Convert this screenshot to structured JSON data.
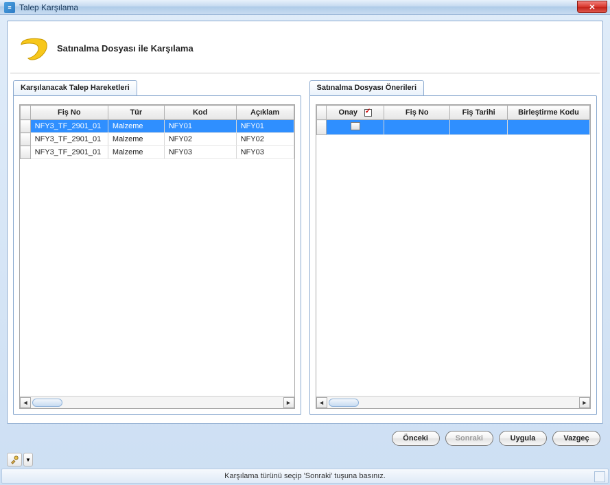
{
  "window": {
    "title": "Talep Karşılama"
  },
  "header": {
    "title": "Satınalma Dosyası ile Karşılama"
  },
  "left_panel": {
    "title": "Karşılanacak Talep Hareketleri",
    "columns": {
      "fis_no": "Fiş No",
      "tur": "Tür",
      "kod": "Kod",
      "aciklama": "Açıklam"
    },
    "rows": [
      {
        "fis_no": "NFY3_TF_2901_01",
        "tur": "Malzeme",
        "kod": "NFY01",
        "aciklama": "NFY01",
        "selected": true
      },
      {
        "fis_no": "NFY3_TF_2901_01",
        "tur": "Malzeme",
        "kod": "NFY02",
        "aciklama": "NFY02",
        "selected": false
      },
      {
        "fis_no": "NFY3_TF_2901_01",
        "tur": "Malzeme",
        "kod": "NFY03",
        "aciklama": "NFY03",
        "selected": false
      }
    ]
  },
  "right_panel": {
    "title": "Satınalma Dosyası Önerileri",
    "columns": {
      "onay": "Onay",
      "fis_no": "Fiş No",
      "fis_tarihi": "Fiş Tarihi",
      "birlestirme": "Birleştirme Kodu"
    },
    "rows": [
      {
        "onay": "",
        "fis_no": "",
        "fis_tarihi": "",
        "birlestirme": "",
        "selected": true
      }
    ]
  },
  "buttons": {
    "prev": "Önceki",
    "next": "Sonraki",
    "apply": "Uygula",
    "cancel": "Vazgeç"
  },
  "status": {
    "text": "Karşılama türünü seçip 'Sonraki' tuşuna basınız."
  }
}
